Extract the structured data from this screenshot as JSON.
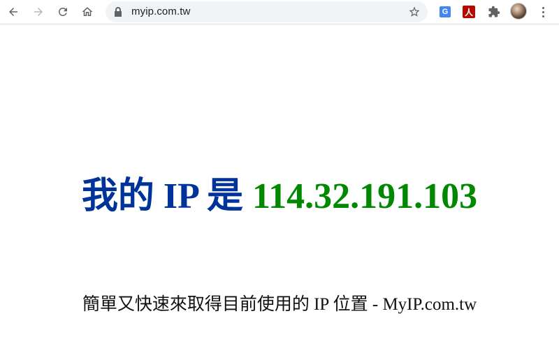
{
  "browser": {
    "url": "myip.com.tw",
    "extensions": [
      {
        "name": "Google Translate",
        "glyph": "G"
      },
      {
        "name": "Adobe Acrobat",
        "glyph": "人"
      }
    ]
  },
  "page": {
    "headline_label": "我的 IP 是",
    "ip_address": "114.32.191.103",
    "tagline": "簡單又快速來取得目前使用的 IP 位置 - MyIP.com.tw"
  },
  "colors": {
    "label": "#003399",
    "ip": "#008800"
  }
}
